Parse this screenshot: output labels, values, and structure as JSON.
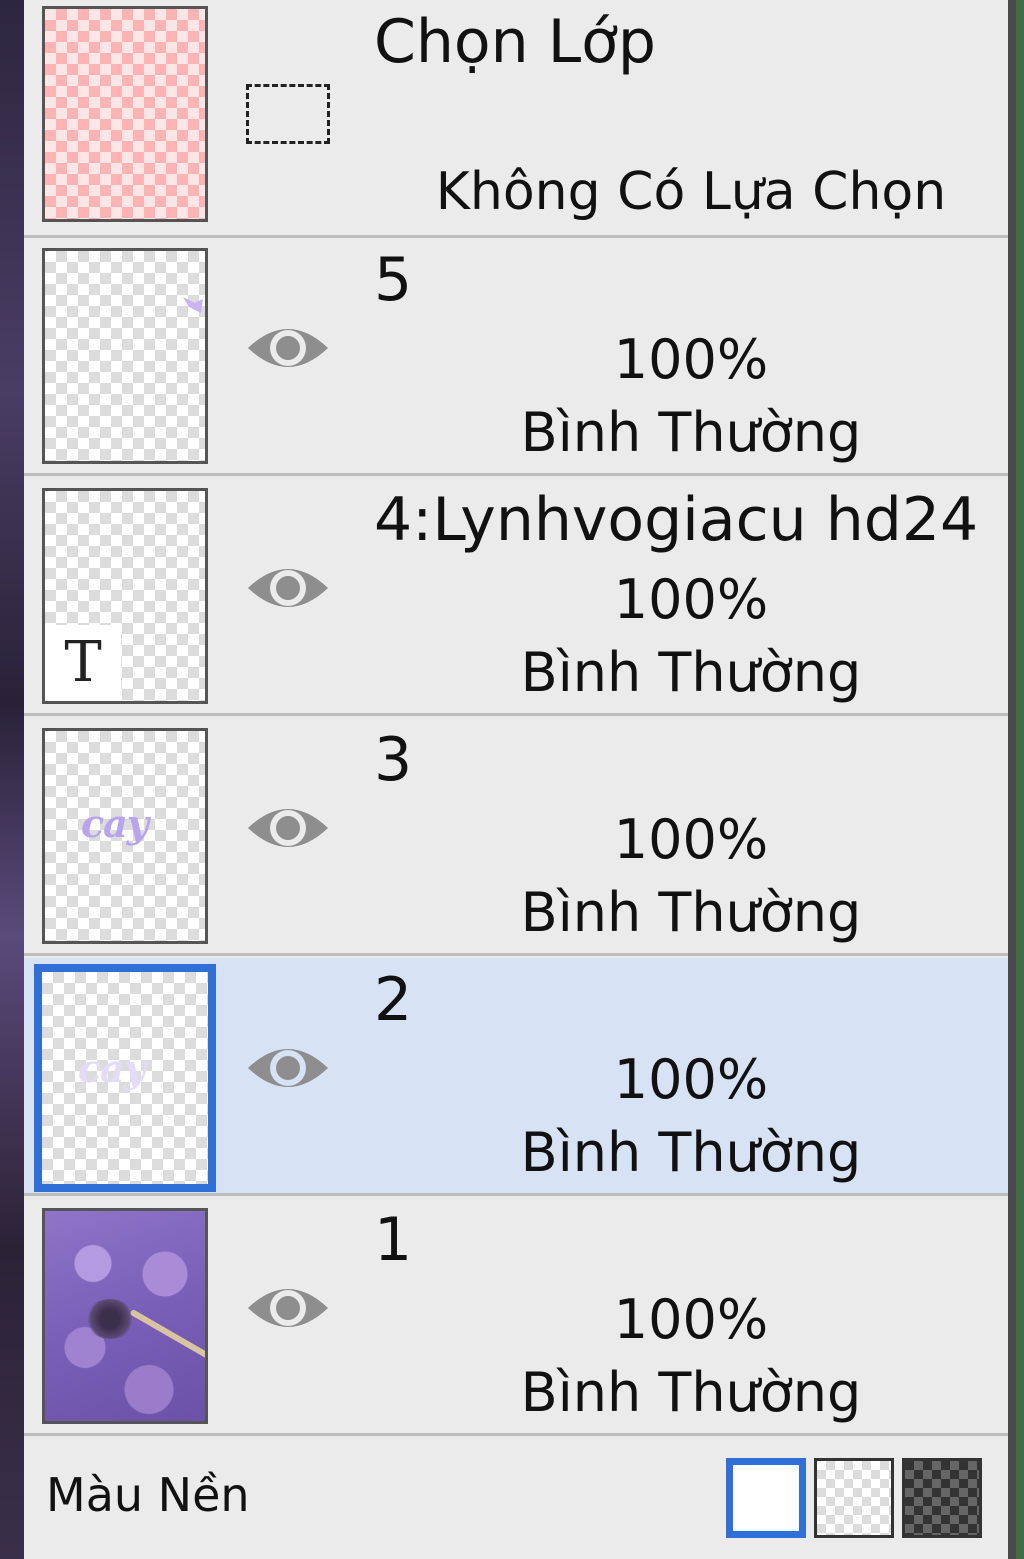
{
  "selection_layer": {
    "title": "Chọn Lớp",
    "subtitle": "Không Có Lựa Chọn"
  },
  "layers": [
    {
      "name": "5",
      "opacity": "100%",
      "blend": "Bình Thường",
      "visible": true
    },
    {
      "name": "4:Lynhvogiacu hd24",
      "opacity": "100%",
      "blend": "Bình Thường",
      "visible": true,
      "type": "text"
    },
    {
      "name": "3",
      "opacity": "100%",
      "blend": "Bình Thường",
      "visible": true,
      "thumb_text": "cay"
    },
    {
      "name": "2",
      "opacity": "100%",
      "blend": "Bình Thường",
      "visible": true,
      "selected": true,
      "thumb_text": "cay"
    },
    {
      "name": "1",
      "opacity": "100%",
      "blend": "Bình Thường",
      "visible": true
    }
  ],
  "text_badge": "T",
  "background": {
    "label": "Màu Nền",
    "options": [
      "white",
      "light-checker",
      "dark-checker"
    ],
    "selected": "white"
  },
  "colors": {
    "selected_row": "#d7e2f5",
    "selection_border": "#2f6fd6",
    "eye_icon": "#8e8e8e"
  }
}
